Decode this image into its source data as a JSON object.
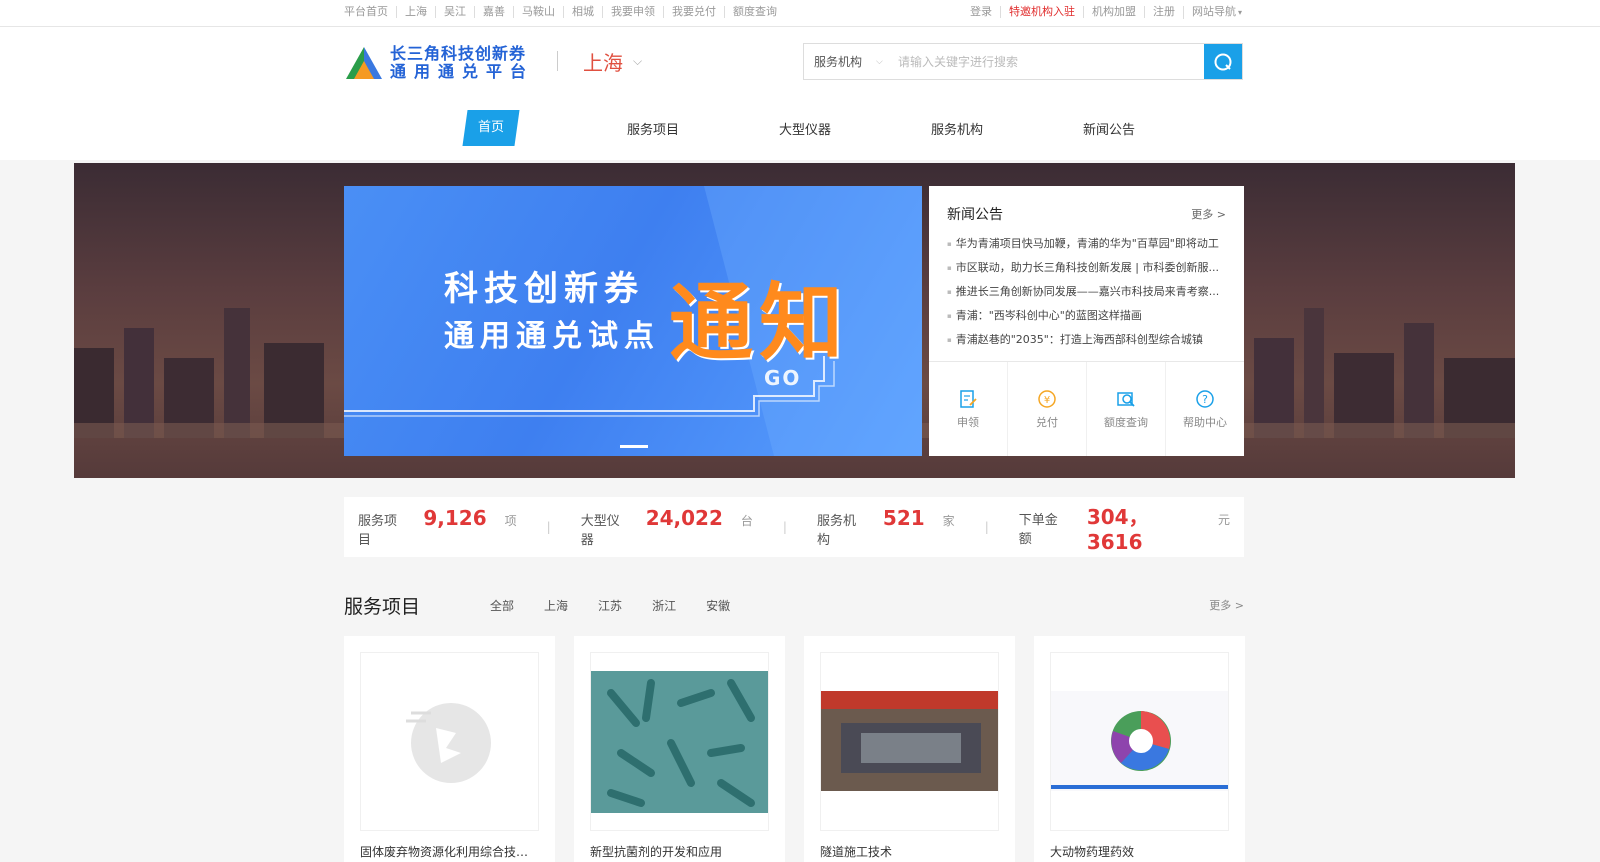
{
  "topbar": {
    "left_links": [
      "平台首页",
      "上海",
      "吴江",
      "嘉善",
      "马鞍山",
      "相城",
      "我要申领",
      "我要兑付",
      "额度查询"
    ],
    "right_links": [
      {
        "label": "登录",
        "highlight": false
      },
      {
        "label": "特邀机构入驻",
        "highlight": true
      },
      {
        "label": "机构加盟",
        "highlight": false
      },
      {
        "label": "注册",
        "highlight": false
      },
      {
        "label": "网站导航",
        "highlight": false
      }
    ]
  },
  "header": {
    "logo_line1": "长三角科技创新券",
    "logo_line2": "通用通兑平台",
    "city": "上海"
  },
  "search": {
    "category": "服务机构",
    "placeholder": "请输入关键字进行搜索",
    "value": ""
  },
  "nav": {
    "items": [
      "首页",
      "服务项目",
      "大型仪器",
      "服务机构",
      "新闻公告"
    ]
  },
  "slide": {
    "line1": "科技创新券",
    "line2": "通用通兑试点",
    "highlight": "通知",
    "go": "GO"
  },
  "news": {
    "title": "新闻公告",
    "more": "更多 >",
    "items": [
      "华为青浦项目快马加鞭，青浦的华为\"百草园\"即将动工",
      "市区联动，助力长三角科技创新发展 | 市科委创新服...",
      "推进长三角创新协同发展——嘉兴市科技局来青考察...",
      "青浦：\"西岑科创中心\"的蓝图这样描画",
      "青浦赵巷的\"2035\"：打造上海西部科创型综合城镇"
    ],
    "quick": [
      {
        "label": "申领",
        "icon": "apply-icon"
      },
      {
        "label": "兑付",
        "icon": "redeem-icon"
      },
      {
        "label": "额度查询",
        "icon": "quota-icon"
      },
      {
        "label": "帮助中心",
        "icon": "help-icon"
      }
    ]
  },
  "stats": [
    {
      "label": "服务项目",
      "value": "9,126",
      "unit": "项"
    },
    {
      "label": "大型仪器",
      "value": "24,022",
      "unit": "台"
    },
    {
      "label": "服务机构",
      "value": "521",
      "unit": "家"
    },
    {
      "label": "下单金额",
      "value": "304，3616",
      "unit": "元"
    }
  ],
  "services": {
    "title": "服务项目",
    "tabs": [
      "全部",
      "上海",
      "江苏",
      "浙江",
      "安徽"
    ],
    "more": "更多 >",
    "cards": [
      {
        "name": "固体废弃物资源化利用综合技术..."
      },
      {
        "name": "新型抗菌剂的开发和应用"
      },
      {
        "name": "隧道施工技术"
      },
      {
        "name": "大动物药理药效"
      }
    ]
  },
  "colors": {
    "accent": "#1aa0e8",
    "highlight_red": "#e03838",
    "city_red": "#e05040",
    "slide_orange": "#ff8a1d"
  }
}
